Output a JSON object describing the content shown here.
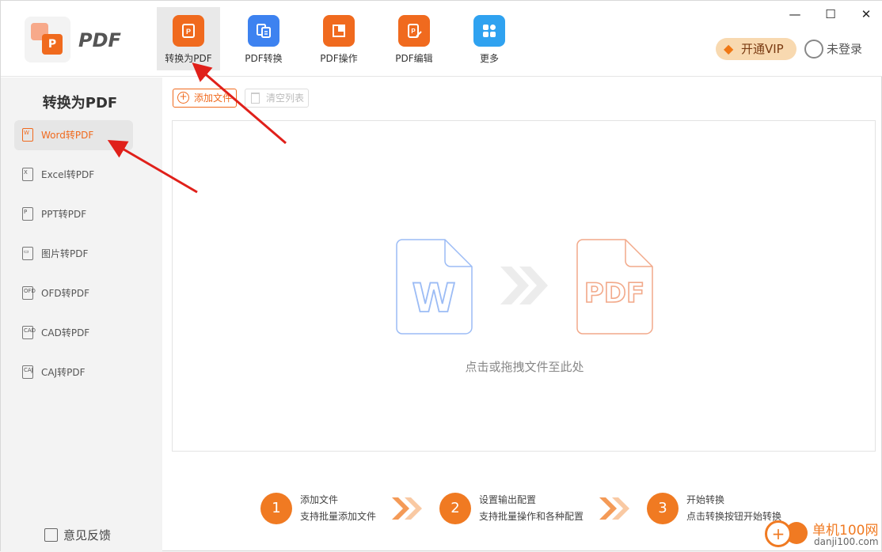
{
  "app": {
    "logo_text": "PDF"
  },
  "nav": [
    {
      "label": "转换为PDF",
      "icon": "convert-to-pdf-icon",
      "color": "#f06a1e",
      "glyph": "P"
    },
    {
      "label": "PDF转换",
      "icon": "pdf-convert-icon",
      "color": "#3d82f0",
      "glyph": "⇄"
    },
    {
      "label": "PDF操作",
      "icon": "pdf-operate-icon",
      "color": "#f06a1e",
      "glyph": "◧"
    },
    {
      "label": "PDF编辑",
      "icon": "pdf-edit-icon",
      "color": "#f06a1e",
      "glyph": "✎"
    },
    {
      "label": "更多",
      "icon": "more-grid-icon",
      "color": "#2fa2f0",
      "glyph": "▦"
    }
  ],
  "window": {
    "minimize": "—",
    "maximize": "☐",
    "close": "✕"
  },
  "vip": {
    "label": "开通VIP"
  },
  "login": {
    "label": "未登录"
  },
  "sidebar": {
    "title": "转换为PDF",
    "items": [
      {
        "label": "Word转PDF",
        "icon_text": "W"
      },
      {
        "label": "Excel转PDF",
        "icon_text": "X"
      },
      {
        "label": "PPT转PDF",
        "icon_text": "P"
      },
      {
        "label": "图片转PDF",
        "icon_text": "▭"
      },
      {
        "label": "OFD转PDF",
        "icon_text": "OFD"
      },
      {
        "label": "CAD转PDF",
        "icon_text": "CAD"
      },
      {
        "label": "CAJ转PDF",
        "icon_text": "CAJ"
      }
    ],
    "feedback": "意见反馈"
  },
  "toolbar": {
    "add": "添加文件",
    "clear": "清空列表"
  },
  "dropzone": {
    "hint": "点击或拖拽文件至此处",
    "word_letter": "W",
    "pdf_text": "PDF"
  },
  "steps": [
    {
      "num": "1",
      "title": "添加文件",
      "desc": "支持批量添加文件"
    },
    {
      "num": "2",
      "title": "设置输出配置",
      "desc": "支持批量操作和各种配置"
    },
    {
      "num": "3",
      "title": "开始转换",
      "desc": "点击转换按钮开始转换"
    }
  ],
  "watermark": {
    "name": "单机100网",
    "url": "danji100.com"
  }
}
